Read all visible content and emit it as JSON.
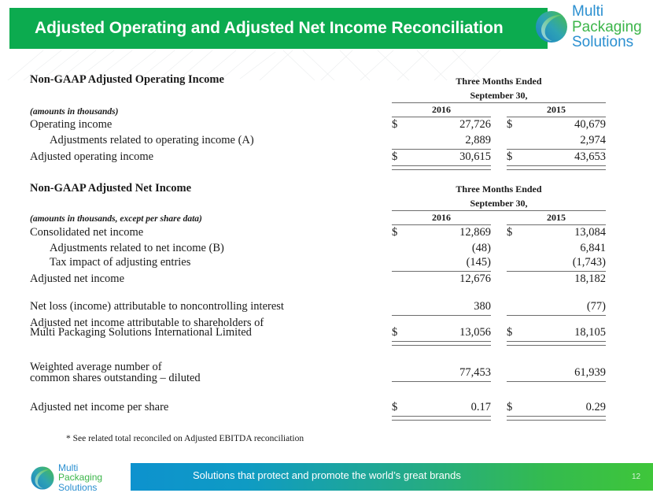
{
  "header": {
    "title": "Adjusted Operating and Adjusted Net Income Reconciliation",
    "banner_color": "#0cab4f"
  },
  "logo": {
    "line1": "Multi",
    "line2": "Packaging",
    "line3": "Solutions",
    "blue": "#2a8fd0",
    "green": "#3cb54a"
  },
  "section1": {
    "heading": "Non-GAAP Adjusted Operating Income",
    "units_note": "(amounts in thousands)",
    "period_line1": "Three Months Ended",
    "period_line2": "September 30,",
    "col_2016": "2016",
    "col_2015": "2015",
    "rows": [
      {
        "label": "Operating income",
        "currency_2016": "$",
        "value_2016": "27,726",
        "currency_2015": "$",
        "value_2015": "40,679"
      },
      {
        "label": "Adjustments related to operating income (A)",
        "currency_2016": "",
        "value_2016": "2,889",
        "currency_2015": "",
        "value_2015": "2,974"
      },
      {
        "label": "Adjusted operating income",
        "currency_2016": "$",
        "value_2016": "30,615",
        "currency_2015": "$",
        "value_2015": "43,653"
      }
    ]
  },
  "section2": {
    "heading": "Non-GAAP Adjusted Net Income",
    "units_note": "(amounts in thousands, except per share data)",
    "period_line1": "Three Months Ended",
    "period_line2": "September 30,",
    "col_2016": "2016",
    "col_2015": "2015",
    "rows": [
      {
        "label": "Consolidated net income",
        "currency_2016": "$",
        "value_2016": "12,869",
        "currency_2015": "$",
        "value_2015": "13,084"
      },
      {
        "label": "Adjustments related to net income (B)",
        "currency_2016": "",
        "value_2016": "(48)",
        "currency_2015": "",
        "value_2015": "6,841"
      },
      {
        "label": "Tax impact of adjusting entries",
        "currency_2016": "",
        "value_2016": "(145)",
        "currency_2015": "",
        "value_2015": "(1,743)"
      },
      {
        "label": "Adjusted net income",
        "currency_2016": "",
        "value_2016": "12,676",
        "currency_2015": "",
        "value_2015": "18,182"
      }
    ],
    "noncontrolling": {
      "label": "Net loss (income) attributable to noncontrolling interest",
      "value_2016": "380",
      "value_2015": "(77)"
    },
    "attributable": {
      "label_line1": "Adjusted net income attributable to shareholders of",
      "label_line2": "Multi Packaging Solutions International Limited",
      "currency_2016": "$",
      "value_2016": "13,056",
      "currency_2015": "$",
      "value_2015": "18,105"
    },
    "shares": {
      "label_line1": "Weighted average number of",
      "label_line2": "common shares outstanding – diluted",
      "value_2016": "77,453",
      "value_2015": "61,939"
    },
    "per_share": {
      "label": "Adjusted net income per share",
      "currency_2016": "$",
      "value_2016": "0.17",
      "currency_2015": "$",
      "value_2015": "0.29"
    }
  },
  "footnote": "*  See related total reconciled on Adjusted EBITDA reconciliation",
  "footer": {
    "tagline": "Solutions that protect and promote the world’s great brands",
    "page_number": "12",
    "gradient_start": "#0d92ce",
    "gradient_end": "#3fc63a"
  }
}
